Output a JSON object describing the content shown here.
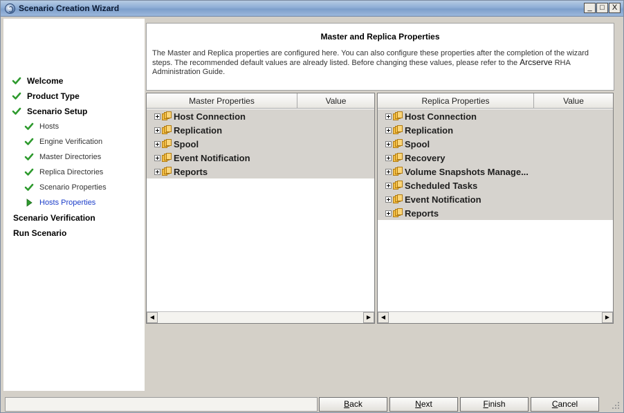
{
  "window": {
    "title": "Scenario Creation Wizard",
    "controls": {
      "minimize": "_",
      "maximize": "□",
      "close": "X"
    }
  },
  "nav": {
    "items": [
      {
        "label": "Welcome",
        "level": "top",
        "status": "done"
      },
      {
        "label": "Product Type",
        "level": "top",
        "status": "done"
      },
      {
        "label": "Scenario Setup",
        "level": "top",
        "status": "done"
      },
      {
        "label": "Hosts",
        "level": "sub",
        "status": "done"
      },
      {
        "label": "Engine Verification",
        "level": "sub",
        "status": "done"
      },
      {
        "label": "Master Directories",
        "level": "sub",
        "status": "done"
      },
      {
        "label": "Replica Directories",
        "level": "sub",
        "status": "done"
      },
      {
        "label": "Scenario Properties",
        "level": "sub",
        "status": "done"
      },
      {
        "label": "Hosts Properties",
        "level": "sub",
        "status": "current"
      },
      {
        "label": "Scenario Verification",
        "level": "top",
        "status": "pending"
      },
      {
        "label": "Run Scenario",
        "level": "top",
        "status": "pending"
      }
    ],
    "colors": {
      "check": "#2e9a2e",
      "current": "#1a3cc9"
    }
  },
  "header": {
    "title": "Master and Replica Properties",
    "description_part1": "The Master and Replica properties are configured here. You can also configure these properties after the completion of the wizard steps. The recommended default values are already listed. Before changing these values, please refer to the ",
    "brand": "Arcserve",
    "description_part2": " RHA Administration Guide."
  },
  "master": {
    "columns": {
      "name": "Master Properties",
      "value": "Value"
    },
    "rows": [
      "Host Connection",
      "Replication",
      "Spool",
      "Event Notification",
      "Reports"
    ]
  },
  "replica": {
    "columns": {
      "name": "Replica Properties",
      "value": "Value"
    },
    "rows": [
      "Host Connection",
      "Replication",
      "Spool",
      "Recovery",
      "Volume Snapshots Manage...",
      "Scheduled Tasks",
      "Event Notification",
      "Reports"
    ]
  },
  "buttons": {
    "back": {
      "mnemonic": "B",
      "rest": "ack"
    },
    "next": {
      "mnemonic": "N",
      "rest": "ext"
    },
    "finish": {
      "mnemonic": "F",
      "rest": "inish"
    },
    "cancel": {
      "mnemonic": "C",
      "rest": "ancel"
    }
  },
  "icons": {
    "app": "wizard-app-icon",
    "check": "green-check-icon",
    "current": "green-arrow-icon",
    "property": "property-folder-icon",
    "expand": "plus-expander-icon"
  }
}
